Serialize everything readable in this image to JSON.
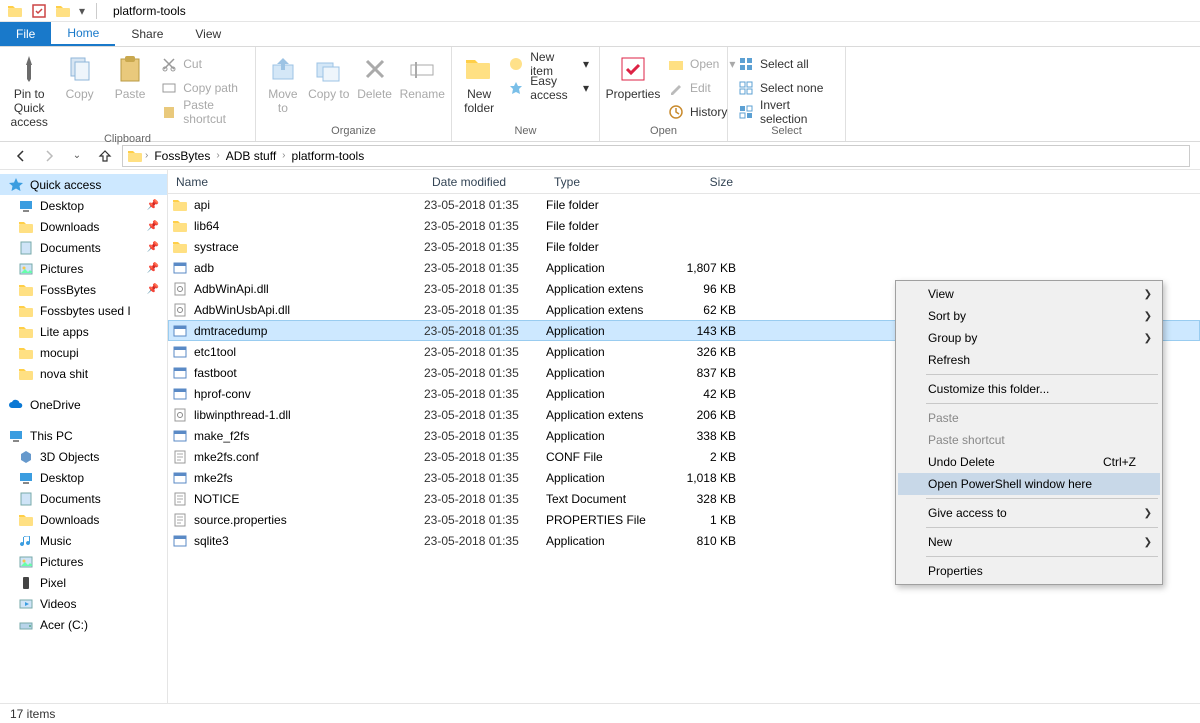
{
  "window": {
    "title": "platform-tools"
  },
  "tabs": {
    "file": "File",
    "home": "Home",
    "share": "Share",
    "view": "View"
  },
  "ribbon": {
    "clipboard": {
      "label": "Clipboard",
      "pin_to_quick": "Pin to Quick access",
      "copy": "Copy",
      "paste": "Paste",
      "cut": "Cut",
      "copy_path": "Copy path",
      "paste_shortcut": "Paste shortcut"
    },
    "organize": {
      "label": "Organize",
      "move_to": "Move to",
      "copy_to": "Copy to",
      "delete": "Delete",
      "rename": "Rename"
    },
    "new": {
      "label": "New",
      "new_folder": "New folder",
      "new_item": "New item",
      "easy_access": "Easy access"
    },
    "open": {
      "label": "Open",
      "properties": "Properties",
      "open": "Open",
      "edit": "Edit",
      "history": "History"
    },
    "select": {
      "label": "Select",
      "select_all": "Select all",
      "select_none": "Select none",
      "invert": "Invert selection"
    }
  },
  "breadcrumbs": [
    "FossBytes",
    "ADB stuff",
    "platform-tools"
  ],
  "columns": {
    "name": "Name",
    "date": "Date modified",
    "type": "Type",
    "size": "Size"
  },
  "navpane": {
    "top1_label": "Quick access",
    "quick_access": [
      {
        "label": "Desktop",
        "pin": true,
        "icon": "desktop"
      },
      {
        "label": "Downloads",
        "pin": true,
        "icon": "folder"
      },
      {
        "label": "Documents",
        "pin": true,
        "icon": "doc"
      },
      {
        "label": "Pictures",
        "pin": true,
        "icon": "pic"
      },
      {
        "label": "FossBytes",
        "pin": true,
        "icon": "folder"
      },
      {
        "label": "Fossbytes used I",
        "pin": false,
        "icon": "folder"
      },
      {
        "label": "Lite apps",
        "pin": false,
        "icon": "folder"
      },
      {
        "label": "mocupi",
        "pin": false,
        "icon": "folder"
      },
      {
        "label": "nova shit",
        "pin": false,
        "icon": "folder"
      }
    ],
    "onedrive": "OneDrive",
    "thispc_label": "This PC",
    "thispc": [
      {
        "label": "3D Objects",
        "icon": "3d"
      },
      {
        "label": "Desktop",
        "icon": "desktop"
      },
      {
        "label": "Documents",
        "icon": "doc"
      },
      {
        "label": "Downloads",
        "icon": "folder"
      },
      {
        "label": "Music",
        "icon": "music"
      },
      {
        "label": "Pictures",
        "icon": "pic"
      },
      {
        "label": "Pixel",
        "icon": "phone"
      },
      {
        "label": "Videos",
        "icon": "video"
      },
      {
        "label": "Acer (C:)",
        "icon": "drive"
      }
    ]
  },
  "files": [
    {
      "name": "api",
      "date": "23-05-2018 01:35",
      "type": "File folder",
      "size": "",
      "icon": "folder"
    },
    {
      "name": "lib64",
      "date": "23-05-2018 01:35",
      "type": "File folder",
      "size": "",
      "icon": "folder"
    },
    {
      "name": "systrace",
      "date": "23-05-2018 01:35",
      "type": "File folder",
      "size": "",
      "icon": "folder"
    },
    {
      "name": "adb",
      "date": "23-05-2018 01:35",
      "type": "Application",
      "size": "1,807 KB",
      "icon": "app"
    },
    {
      "name": "AdbWinApi.dll",
      "date": "23-05-2018 01:35",
      "type": "Application extens",
      "size": "96 KB",
      "icon": "dll"
    },
    {
      "name": "AdbWinUsbApi.dll",
      "date": "23-05-2018 01:35",
      "type": "Application extens",
      "size": "62 KB",
      "icon": "dll"
    },
    {
      "name": "dmtracedump",
      "date": "23-05-2018 01:35",
      "type": "Application",
      "size": "143 KB",
      "icon": "app",
      "selected": true
    },
    {
      "name": "etc1tool",
      "date": "23-05-2018 01:35",
      "type": "Application",
      "size": "326 KB",
      "icon": "app"
    },
    {
      "name": "fastboot",
      "date": "23-05-2018 01:35",
      "type": "Application",
      "size": "837 KB",
      "icon": "app"
    },
    {
      "name": "hprof-conv",
      "date": "23-05-2018 01:35",
      "type": "Application",
      "size": "42 KB",
      "icon": "app"
    },
    {
      "name": "libwinpthread-1.dll",
      "date": "23-05-2018 01:35",
      "type": "Application extens",
      "size": "206 KB",
      "icon": "dll"
    },
    {
      "name": "make_f2fs",
      "date": "23-05-2018 01:35",
      "type": "Application",
      "size": "338 KB",
      "icon": "app"
    },
    {
      "name": "mke2fs.conf",
      "date": "23-05-2018 01:35",
      "type": "CONF File",
      "size": "2 KB",
      "icon": "txt"
    },
    {
      "name": "mke2fs",
      "date": "23-05-2018 01:35",
      "type": "Application",
      "size": "1,018 KB",
      "icon": "app"
    },
    {
      "name": "NOTICE",
      "date": "23-05-2018 01:35",
      "type": "Text Document",
      "size": "328 KB",
      "icon": "txt"
    },
    {
      "name": "source.properties",
      "date": "23-05-2018 01:35",
      "type": "PROPERTIES File",
      "size": "1 KB",
      "icon": "txt"
    },
    {
      "name": "sqlite3",
      "date": "23-05-2018 01:35",
      "type": "Application",
      "size": "810 KB",
      "icon": "app"
    }
  ],
  "context_menu": {
    "view": "View",
    "sort_by": "Sort by",
    "group_by": "Group by",
    "refresh": "Refresh",
    "customize": "Customize this folder...",
    "paste": "Paste",
    "paste_shortcut": "Paste shortcut",
    "undo_delete": "Undo Delete",
    "undo_shortcut": "Ctrl+Z",
    "open_powershell": "Open PowerShell window here",
    "give_access": "Give access to",
    "new": "New",
    "properties": "Properties"
  },
  "status": {
    "count_label": "17 items"
  }
}
